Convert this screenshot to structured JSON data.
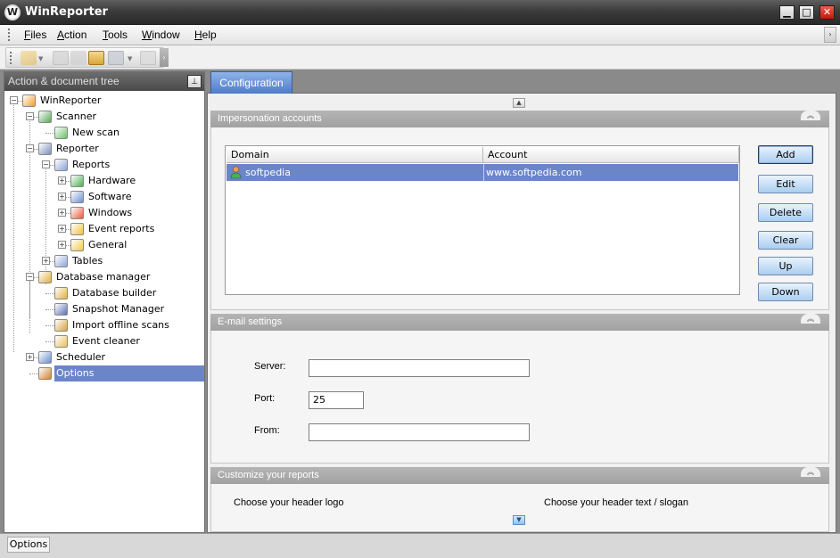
{
  "window": {
    "title": "WinReporter",
    "logo_letter": "W",
    "minimize": "▁",
    "maximize": "□",
    "close": "✕"
  },
  "menu": {
    "items": [
      "Files",
      "Action",
      "Tools",
      "Window",
      "Help"
    ],
    "overflow": "›"
  },
  "toolbar": {
    "overflow": "›"
  },
  "tree": {
    "title": "Action & document tree",
    "pin": "📌",
    "nodes": [
      {
        "label": "WinReporter",
        "icon": "winreporter-icon"
      },
      {
        "label": "Scanner",
        "icon": "scanner-icon"
      },
      {
        "label": "New scan",
        "icon": "new-scan-icon"
      },
      {
        "label": "Reporter",
        "icon": "reporter-icon"
      },
      {
        "label": "Reports",
        "icon": "reports-icon"
      },
      {
        "label": "Hardware",
        "icon": "hardware-icon"
      },
      {
        "label": "Software",
        "icon": "software-icon"
      },
      {
        "label": "Windows",
        "icon": "windows-icon"
      },
      {
        "label": "Event reports",
        "icon": "event-reports-icon"
      },
      {
        "label": "General",
        "icon": "general-icon"
      },
      {
        "label": "Tables",
        "icon": "tables-icon"
      },
      {
        "label": "Database manager",
        "icon": "database-icon"
      },
      {
        "label": "Database builder",
        "icon": "database-builder-icon"
      },
      {
        "label": "Snapshot Manager",
        "icon": "snapshot-icon"
      },
      {
        "label": "Import offline scans",
        "icon": "import-icon"
      },
      {
        "label": "Event cleaner",
        "icon": "event-cleaner-icon"
      },
      {
        "label": "Scheduler",
        "icon": "scheduler-icon"
      },
      {
        "label": "Options",
        "icon": "options-icon",
        "selected": true
      }
    ]
  },
  "tabs": {
    "active": "Configuration"
  },
  "impersonation": {
    "title": "Impersonation accounts",
    "columns": [
      "Domain",
      "Account"
    ],
    "rows": [
      {
        "domain": "softpedia",
        "account": "www.softpedia.com"
      }
    ],
    "buttons": {
      "add": "Add",
      "edit": "Edit",
      "delete": "Delete",
      "clear": "Clear",
      "up": "Up",
      "down": "Down"
    }
  },
  "email": {
    "title": "E-mail settings",
    "server_label": "Server:",
    "server_value": "",
    "port_label": "Port:",
    "port_value": "25",
    "from_label": "From:",
    "from_value": ""
  },
  "customize": {
    "title": "Customize your reports",
    "header_logo": "Choose your header logo",
    "header_text": "Choose your header text / slogan"
  },
  "status": {
    "panel": "Options"
  },
  "colors": {
    "selection": "#6b85c9",
    "tab": "#5a86cf",
    "button": "#a9cdee"
  }
}
